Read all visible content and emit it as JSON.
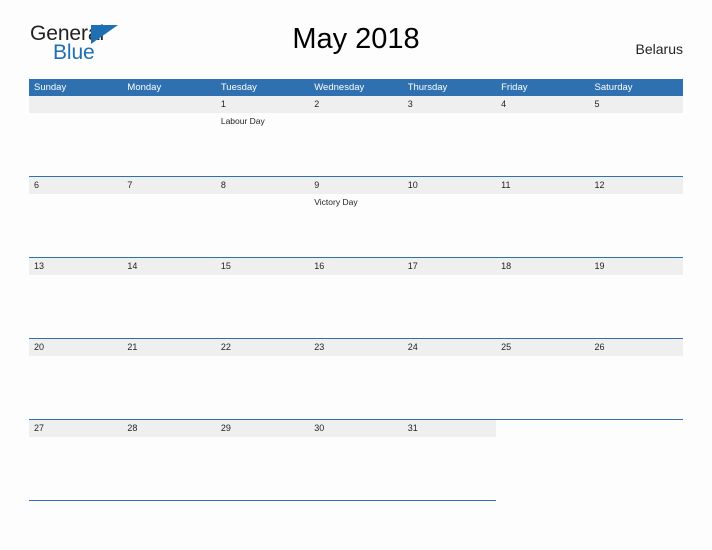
{
  "logo": {
    "word_top": "General",
    "word_bottom": "Blue",
    "triangle_color": "#1f6fb4",
    "icon": "triangle-icon"
  },
  "header": {
    "title": "May 2018",
    "region": "Belarus"
  },
  "theme": {
    "accent": "#2e70b0",
    "band": "#efefef",
    "page_background": "#fdfdfd",
    "text": "#231f20"
  },
  "calendar": {
    "weekdays": [
      "Sunday",
      "Monday",
      "Tuesday",
      "Wednesday",
      "Thursday",
      "Friday",
      "Saturday"
    ],
    "weeks": [
      [
        {
          "day": "",
          "event": ""
        },
        {
          "day": "",
          "event": ""
        },
        {
          "day": "1",
          "event": "Labour Day"
        },
        {
          "day": "2",
          "event": ""
        },
        {
          "day": "3",
          "event": ""
        },
        {
          "day": "4",
          "event": ""
        },
        {
          "day": "5",
          "event": ""
        }
      ],
      [
        {
          "day": "6",
          "event": ""
        },
        {
          "day": "7",
          "event": ""
        },
        {
          "day": "8",
          "event": ""
        },
        {
          "day": "9",
          "event": "Victory Day"
        },
        {
          "day": "10",
          "event": ""
        },
        {
          "day": "11",
          "event": ""
        },
        {
          "day": "12",
          "event": ""
        }
      ],
      [
        {
          "day": "13",
          "event": ""
        },
        {
          "day": "14",
          "event": ""
        },
        {
          "day": "15",
          "event": ""
        },
        {
          "day": "16",
          "event": ""
        },
        {
          "day": "17",
          "event": ""
        },
        {
          "day": "18",
          "event": ""
        },
        {
          "day": "19",
          "event": ""
        }
      ],
      [
        {
          "day": "20",
          "event": ""
        },
        {
          "day": "21",
          "event": ""
        },
        {
          "day": "22",
          "event": ""
        },
        {
          "day": "23",
          "event": ""
        },
        {
          "day": "24",
          "event": ""
        },
        {
          "day": "25",
          "event": ""
        },
        {
          "day": "26",
          "event": ""
        }
      ],
      [
        {
          "day": "27",
          "event": ""
        },
        {
          "day": "28",
          "event": ""
        },
        {
          "day": "29",
          "event": ""
        },
        {
          "day": "30",
          "event": ""
        },
        {
          "day": "31",
          "event": ""
        },
        {
          "day": "",
          "event": ""
        },
        {
          "day": "",
          "event": ""
        }
      ]
    ]
  }
}
